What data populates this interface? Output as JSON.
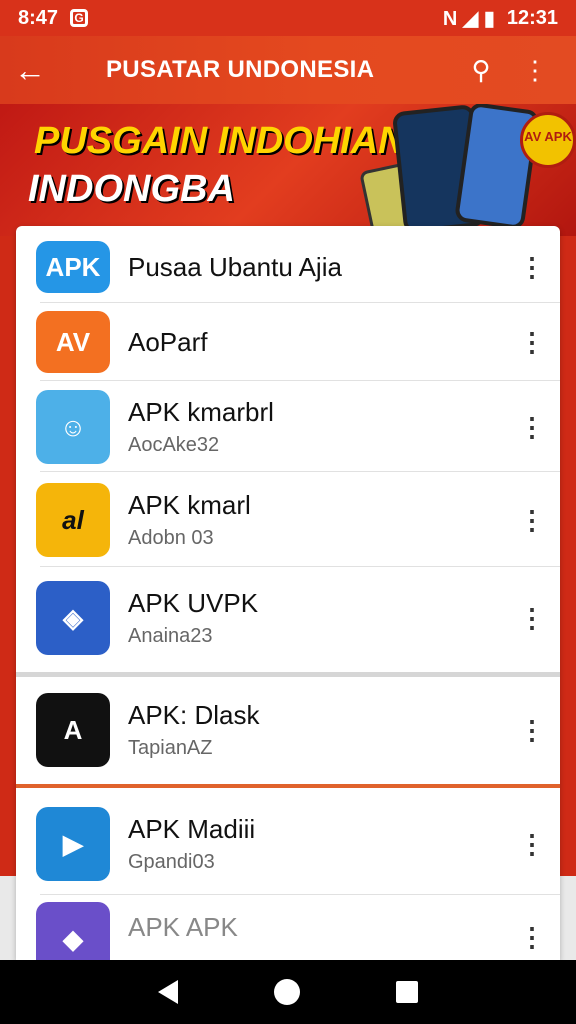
{
  "status": {
    "time": "8:47",
    "app_icon": "G",
    "clock": "12:31",
    "signal_icons": "N ◢ ▮"
  },
  "app_bar": {
    "title": "PUSATAR UNDONESIA",
    "back_icon": "←",
    "search_icon": "⚲",
    "more_icon": "⋮"
  },
  "banner": {
    "line1": "PUSGAIN INDOHIAN",
    "line2": "INDONGBA",
    "badge": "AV APK"
  },
  "apps": [
    {
      "name": "Pusaa Ubantu Ajia",
      "sub": "",
      "icon_text": "APK",
      "icon_color": "#2596e6"
    },
    {
      "name": "AoParf",
      "sub": "",
      "icon_text": "AV",
      "icon_color": "#f37021"
    },
    {
      "name": "APK kmarbrl",
      "sub": "AocAke32",
      "icon_text": "☺",
      "icon_color": "#4db0e8"
    },
    {
      "name": "APK kmarl",
      "sub": "Adobn 03",
      "icon_text": "al",
      "icon_color": "#f5b50a"
    },
    {
      "name": "APK UVPK",
      "sub": "Anaina23",
      "icon_text": "◈",
      "icon_color": "#2c5fc7"
    },
    {
      "name": "APK: Dlask",
      "sub": "TapianAZ",
      "icon_text": "A",
      "icon_color": "#111111"
    },
    {
      "name": "APK Madiii",
      "sub": "Gpandi03",
      "icon_text": "▶",
      "icon_color": "#1f88d6"
    },
    {
      "name": "APK APK",
      "sub": "",
      "icon_text": "◆",
      "icon_color": "#6a4fc9"
    }
  ],
  "row_more_icon": "⋮",
  "nav": {
    "back": "back",
    "home": "home",
    "recent": "recent"
  }
}
